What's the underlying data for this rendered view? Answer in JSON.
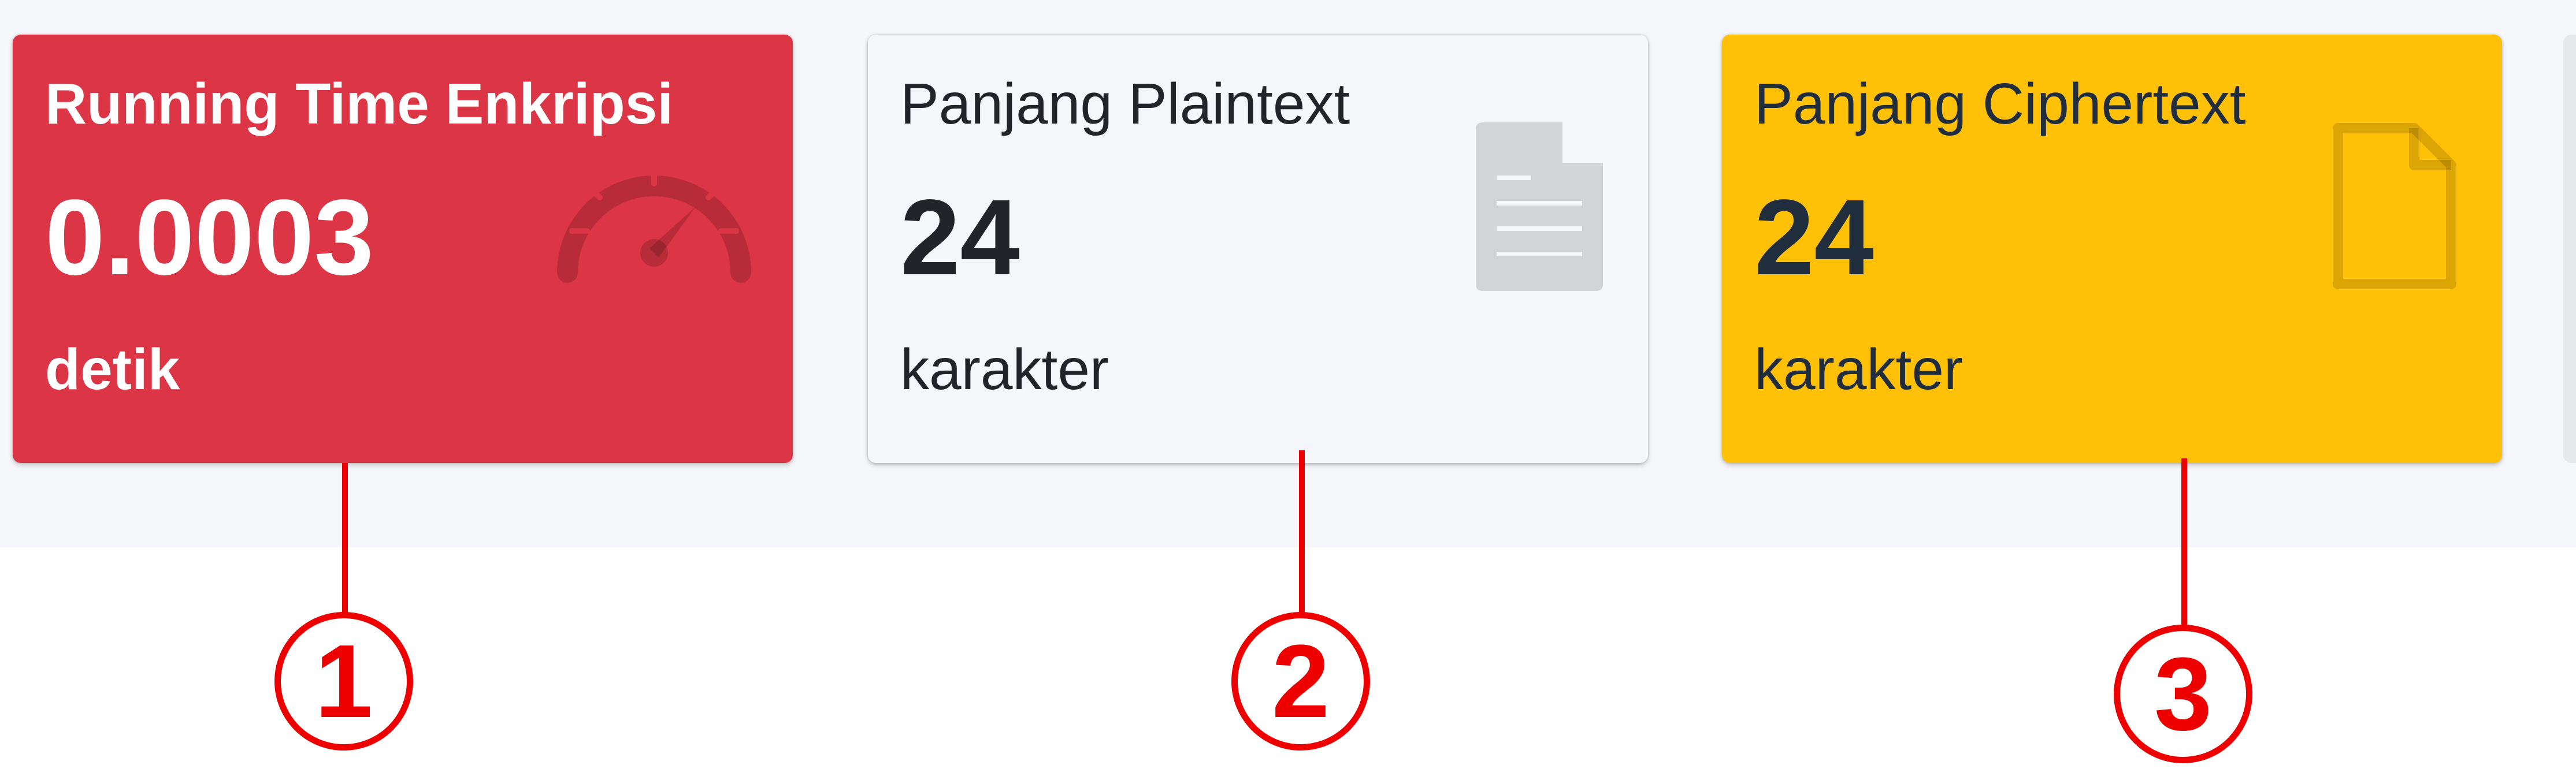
{
  "cards": [
    {
      "title": "Running Time Enkripsi",
      "value": "0.0003",
      "unit": "detik",
      "icon": "speedometer-icon",
      "color": "#dc3545"
    },
    {
      "title": "Panjang Plaintext",
      "value": "24",
      "unit": "karakter",
      "icon": "file-text-icon",
      "color": "#f4f6f9"
    },
    {
      "title": "Panjang Ciphertext",
      "value": "24",
      "unit": "karakter",
      "icon": "file-icon",
      "color": "#ffc107"
    }
  ],
  "callouts": [
    {
      "label": "1",
      "color": "#ee0000"
    },
    {
      "label": "2",
      "color": "#ee0000"
    },
    {
      "label": "3",
      "color": "#ee0000"
    }
  ]
}
